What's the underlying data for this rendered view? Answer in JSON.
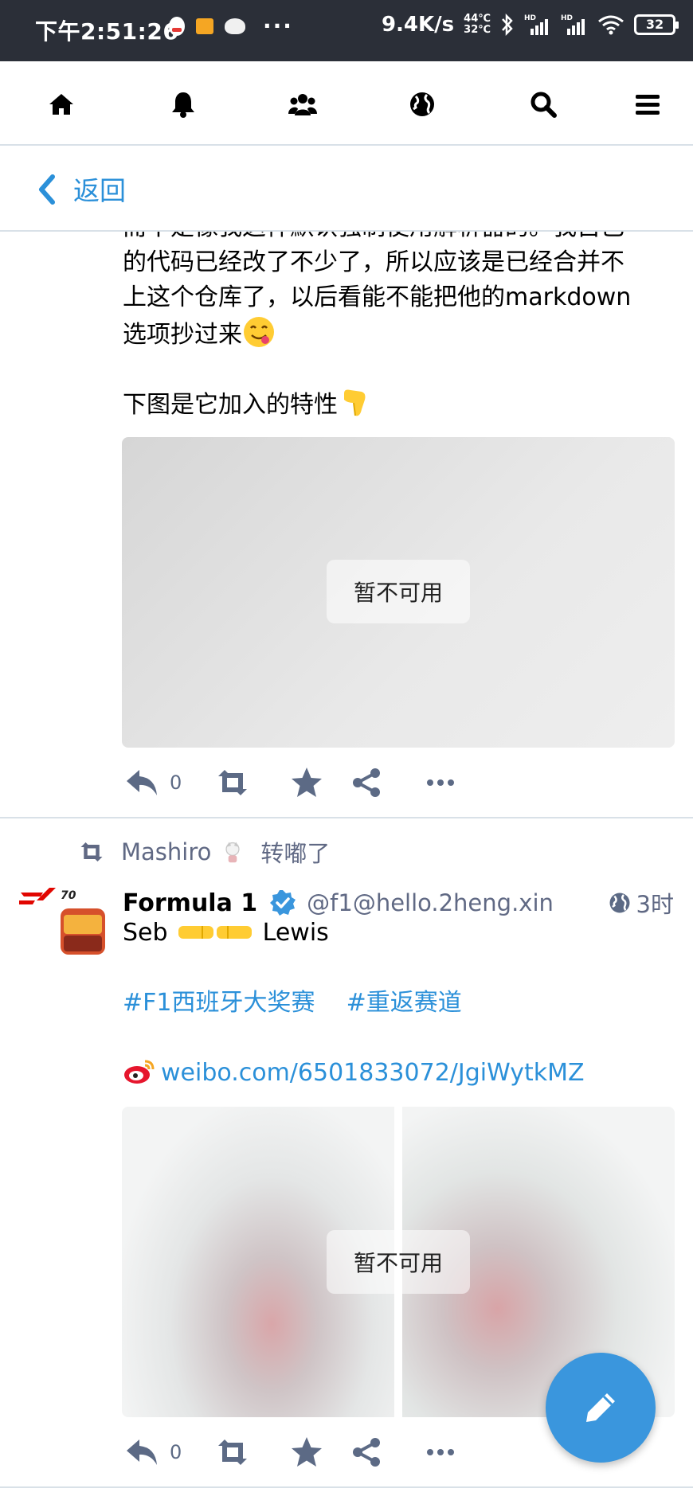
{
  "status_bar": {
    "time": "下午2:51:26",
    "network_speed": "9.4K/s",
    "temp_top": "44℃",
    "temp_bottom": "32℃",
    "battery": "32",
    "more": "···"
  },
  "nav": {
    "items": [
      "home-icon",
      "bell-icon",
      "users-icon",
      "globe-icon",
      "search-icon",
      "menu-icon"
    ]
  },
  "header": {
    "back_label": "返回"
  },
  "post1": {
    "text_partial": "而不是像我这样默认强制使用解析器的。我自己",
    "text_line2": "的代码已经改了不少了，所以应该是已经合并不",
    "text_line3": "上这个仓库了，以后看能不能把他的markdown",
    "text_line4": "选项抄过来",
    "text_line5": "下图是它加入的特性",
    "media_label": "暂不可用",
    "reply_count": "0"
  },
  "post2": {
    "booster_name": "Mashiro",
    "boost_action": "转嘟了",
    "author_name": "Formula 1",
    "author_handle": "@f1@hello.2heng.xin",
    "timestamp": "3时",
    "text_seb": "Seb",
    "text_lewis": "Lewis",
    "tag1": "#F1西班牙大奖赛",
    "tag2": "#重返赛道",
    "link": "weibo.com/6501833072/JgiWytkMZ",
    "media_label": "暂不可用",
    "reply_count": "0"
  },
  "colors": {
    "accent": "#2b90d9",
    "status_bar_bg": "#2b2f38",
    "muted_text": "#606984",
    "fab_bg": "#3a96dd"
  }
}
